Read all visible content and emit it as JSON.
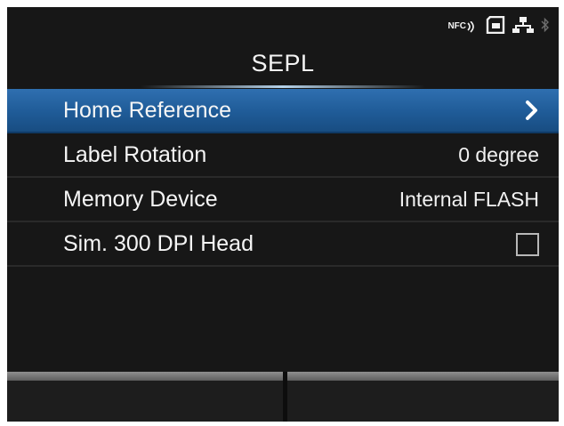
{
  "status": {
    "nfc_label": "NFC"
  },
  "header": {
    "title": "SEPL"
  },
  "menu": {
    "items": [
      {
        "label": "Home Reference",
        "value": "",
        "control": "chevron",
        "selected": true
      },
      {
        "label": "Label Rotation",
        "value": "0 degree",
        "control": "value",
        "selected": false
      },
      {
        "label": "Memory Device",
        "value": "Internal FLASH",
        "control": "value",
        "selected": false
      },
      {
        "label": "Sim. 300 DPI Head",
        "value": "",
        "control": "checkbox",
        "checked": false,
        "selected": false
      }
    ]
  },
  "icons": [
    "nfc-icon",
    "sd-card-icon",
    "network-icon",
    "bluetooth-icon",
    "chevron-right-icon"
  ],
  "colors": {
    "screen_bg": "#171717",
    "selected_row": "#1f5b97",
    "text": "#f5f5f5"
  }
}
